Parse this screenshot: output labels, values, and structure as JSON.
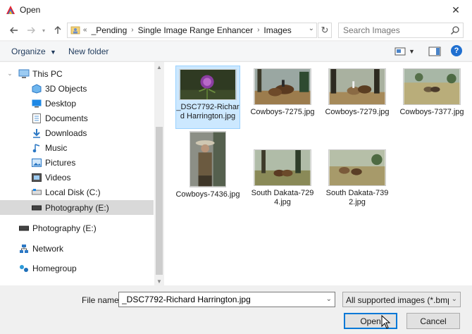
{
  "window": {
    "title": "Open",
    "close_label": "✕"
  },
  "nav": {
    "back_icon": "back-arrow-icon",
    "forward_icon": "forward-arrow-icon",
    "up_icon": "up-arrow-icon"
  },
  "address": {
    "prefix": "«",
    "crumbs": [
      "_Pending",
      "Single Image Range Enhancer",
      "Images"
    ]
  },
  "search": {
    "placeholder": "Search Images"
  },
  "toolbar": {
    "organize_label": "Organize",
    "newfolder_label": "New folder",
    "help_label": "?"
  },
  "sidebar": {
    "items": [
      {
        "label": "This PC",
        "icon": "computer-icon"
      },
      {
        "label": "3D Objects",
        "icon": "3d-objects-icon"
      },
      {
        "label": "Desktop",
        "icon": "desktop-icon"
      },
      {
        "label": "Documents",
        "icon": "documents-icon"
      },
      {
        "label": "Downloads",
        "icon": "downloads-icon"
      },
      {
        "label": "Music",
        "icon": "music-icon"
      },
      {
        "label": "Pictures",
        "icon": "pictures-icon"
      },
      {
        "label": "Videos",
        "icon": "videos-icon"
      },
      {
        "label": "Local Disk (C:)",
        "icon": "local-disk-icon"
      },
      {
        "label": "Photography (E:)",
        "icon": "drive-icon"
      },
      {
        "label": "Photography (E:)",
        "icon": "drive-icon"
      },
      {
        "label": "Network",
        "icon": "network-icon"
      },
      {
        "label": "Homegroup",
        "icon": "homegroup-icon"
      }
    ]
  },
  "files": [
    {
      "name": "_DSC7792-Richard Harrington.jpg",
      "selected": true
    },
    {
      "name": "Cowboys-7275.jpg",
      "selected": false
    },
    {
      "name": "Cowboys-7279.jpg",
      "selected": false
    },
    {
      "name": "Cowboys-7377.jpg",
      "selected": false
    },
    {
      "name": "Cowboys-7436.jpg",
      "selected": false
    },
    {
      "name": "South Dakata-7294.jpg",
      "selected": false
    },
    {
      "name": "South Dakata-7392.jpg",
      "selected": false
    }
  ],
  "footer": {
    "filename_label": "File name:",
    "filename_value": "_DSC7792-Richard Harrington.jpg",
    "filter_value": "All supported images (*.bmp;*.",
    "open_label": "Open",
    "cancel_label": "Cancel"
  },
  "colors": {
    "accent": "#0078d7",
    "selection": "#cce8ff",
    "link": "#1e395b"
  }
}
